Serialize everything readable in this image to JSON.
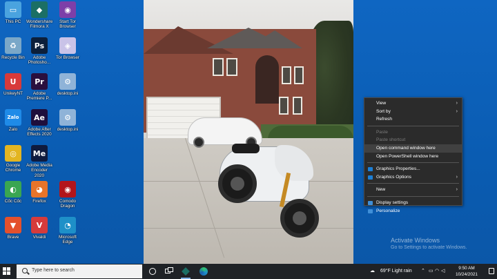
{
  "desktop_icons": [
    {
      "label": "This PC",
      "icon": "computer-icon",
      "color": "#4aa3df",
      "glyph": "▭"
    },
    {
      "label": "Wondershare Filmora X",
      "icon": "filmora-icon",
      "color": "#1b6f65",
      "glyph": "◆"
    },
    {
      "label": "Start Tor Browser",
      "icon": "tor-browser-icon",
      "color": "#7d3fa8",
      "glyph": "◉"
    },
    {
      "label": "Recycle Bin",
      "icon": "recycle-bin-icon",
      "color": "#7aa7c8",
      "glyph": "♻"
    },
    {
      "label": "Adobe Photosho...",
      "icon": "photoshop-icon",
      "color": "#0c1f3a",
      "glyph": "Ps"
    },
    {
      "label": "Tor Browser",
      "icon": "tor-folder-icon",
      "color": "#c9c3e8",
      "glyph": "◈"
    },
    {
      "label": "UnikeyNT",
      "icon": "unikey-icon",
      "color": "#d83a3a",
      "glyph": "U"
    },
    {
      "label": "Adobe Premiere P...",
      "icon": "premiere-icon",
      "color": "#2a0f3e",
      "glyph": "Pr"
    },
    {
      "label": "desktop.ini",
      "icon": "ini-file-icon",
      "color": "#8fb3d8",
      "glyph": "⚙"
    },
    {
      "label": "Zalo",
      "icon": "zalo-icon",
      "color": "#1f8be8",
      "glyph": "Zalo"
    },
    {
      "label": "Adobe After Effects 2020",
      "icon": "after-effects-icon",
      "color": "#1e0e3c",
      "glyph": "Ae"
    },
    {
      "label": "desktop.ini",
      "icon": "ini-file-icon",
      "color": "#8fb3d8",
      "glyph": "⚙"
    },
    {
      "label": "Google Chrome",
      "icon": "chrome-icon",
      "color": "#e3b521",
      "glyph": "◎"
    },
    {
      "label": "Adobe Media Encoder 2020",
      "icon": "media-encoder-icon",
      "color": "#0f1b3e",
      "glyph": "Me"
    },
    {
      "label": "Cốc Cốc",
      "icon": "coccoc-icon",
      "color": "#3aa651",
      "glyph": "◐"
    },
    {
      "label": "Firefox",
      "icon": "firefox-icon",
      "color": "#e8742a",
      "glyph": "◕"
    },
    {
      "label": "Comodo Dragon",
      "icon": "comodo-dragon-icon",
      "color": "#b3151b",
      "glyph": "◉"
    },
    {
      "label": "Brave",
      "icon": "brave-icon",
      "color": "#e4502c",
      "glyph": "▼"
    },
    {
      "label": "Vivaldi",
      "icon": "vivaldi-icon",
      "color": "#d63b3b",
      "glyph": "V"
    },
    {
      "label": "Microsoft Edge",
      "icon": "edge-icon",
      "color": "#1e90c8",
      "glyph": "◔"
    }
  ],
  "context_menu": {
    "items": [
      {
        "label": "View",
        "submenu": true,
        "disabled": false
      },
      {
        "label": "Sort by",
        "submenu": true,
        "disabled": false
      },
      {
        "label": "Refresh",
        "submenu": false,
        "disabled": false
      },
      {
        "label": "Paste",
        "submenu": false,
        "disabled": true
      },
      {
        "label": "Paste shortcut",
        "submenu": false,
        "disabled": true
      },
      {
        "label": "Open command window here",
        "submenu": false,
        "disabled": false,
        "hover": true
      },
      {
        "label": "Open PowerShell window here",
        "submenu": false,
        "disabled": false
      },
      {
        "label": "Graphics Properties...",
        "submenu": false,
        "disabled": false,
        "icon": "intel-graphics-icon"
      },
      {
        "label": "Graphics Options",
        "submenu": true,
        "disabled": false,
        "icon": "intel-graphics-icon"
      },
      {
        "label": "New",
        "submenu": true,
        "disabled": false
      },
      {
        "label": "Display settings",
        "submenu": false,
        "disabled": false,
        "icon": "display-icon"
      },
      {
        "label": "Personalize",
        "submenu": false,
        "disabled": false,
        "icon": "personalize-icon"
      }
    ]
  },
  "watermark": {
    "title": "Activate Windows",
    "subtitle": "Go to Settings to activate Windows."
  },
  "taskbar": {
    "search_placeholder": "Type here to search",
    "weather": "69°F  Light rain",
    "time": "9:50 AM",
    "date": "10/24/2021",
    "accent": "#7fb2e8"
  }
}
